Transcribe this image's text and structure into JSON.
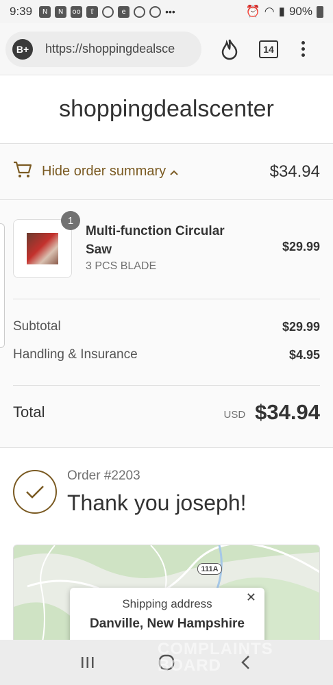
{
  "status_bar": {
    "time": "9:39",
    "battery": "90%",
    "icons": [
      "n-icon",
      "n-icon",
      "voicemail-icon",
      "upload-icon",
      "messenger-icon",
      "ebay-icon",
      "instagram-icon",
      "shield-icon",
      "more-icon"
    ]
  },
  "browser": {
    "url": "https://shoppingdealsce",
    "profile_badge": "B+",
    "tab_count": "14"
  },
  "store": {
    "name": "shoppingdealscenter"
  },
  "summary": {
    "toggle_label": "Hide order summary",
    "total": "$34.94"
  },
  "product": {
    "quantity": "1",
    "name": "Multi-function Circular Saw",
    "variant": "3 PCS BLADE",
    "price": "$29.99"
  },
  "costs": [
    {
      "label": "Subtotal",
      "value": "$29.99"
    },
    {
      "label": "Handling & Insurance",
      "value": "$4.95"
    }
  ],
  "total": {
    "label": "Total",
    "currency": "USD",
    "amount": "$34.94"
  },
  "order": {
    "number": "Order #2203",
    "thanks": "Thank you joseph!"
  },
  "map": {
    "route_shield": "111A",
    "card_title": "Shipping address",
    "card_location": "Danville, New Hampshire"
  },
  "watermark": {
    "line1": "COMPLAINTS",
    "line2": "BOARD"
  },
  "colors": {
    "accent": "#7a5a22"
  }
}
